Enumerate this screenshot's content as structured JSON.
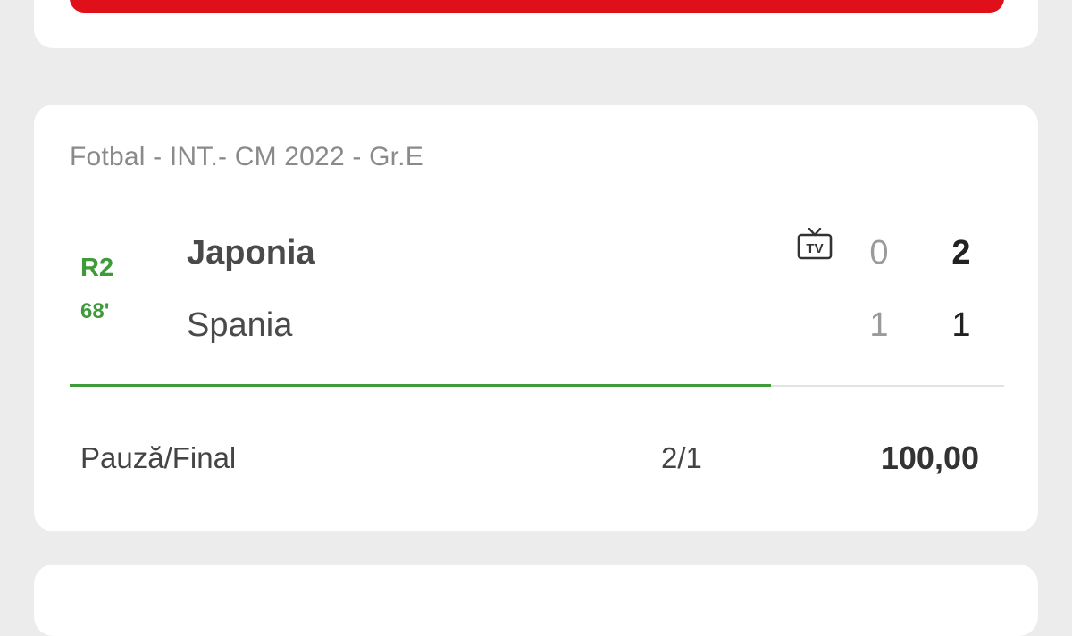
{
  "match_card": {
    "league": "Fotbal - INT.- CM 2022 - Gr.E",
    "status": {
      "period": "R2",
      "minute": "68'"
    },
    "home_team": {
      "name": "Japonia",
      "halftime_score": "0",
      "score": "2"
    },
    "away_team": {
      "name": "Spania",
      "halftime_score": "1",
      "score": "1"
    },
    "tv_icon": "tv-icon",
    "tv_label": "TV",
    "match_progress_fraction": 0.75,
    "bet": {
      "market": "Pauză/Final",
      "pick": "2/1",
      "odds": "100,00"
    }
  },
  "colors": {
    "background": "#ececec",
    "card": "#ffffff",
    "accent_red": "#e0101a",
    "live_green": "#3f9a3a"
  }
}
